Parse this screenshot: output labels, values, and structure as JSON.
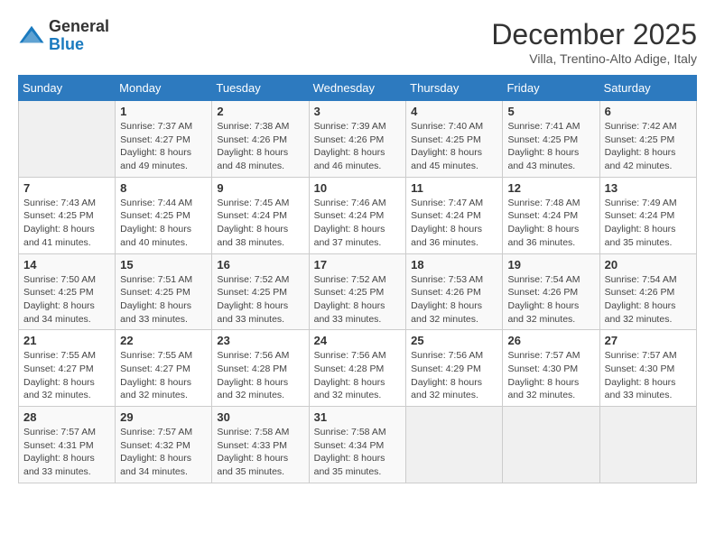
{
  "logo": {
    "line1": "General",
    "line2": "Blue"
  },
  "title": "December 2025",
  "subtitle": "Villa, Trentino-Alto Adige, Italy",
  "weekdays": [
    "Sunday",
    "Monday",
    "Tuesday",
    "Wednesday",
    "Thursday",
    "Friday",
    "Saturday"
  ],
  "weeks": [
    [
      {
        "day": "",
        "info": ""
      },
      {
        "day": "1",
        "info": "Sunrise: 7:37 AM\nSunset: 4:27 PM\nDaylight: 8 hours\nand 49 minutes."
      },
      {
        "day": "2",
        "info": "Sunrise: 7:38 AM\nSunset: 4:26 PM\nDaylight: 8 hours\nand 48 minutes."
      },
      {
        "day": "3",
        "info": "Sunrise: 7:39 AM\nSunset: 4:26 PM\nDaylight: 8 hours\nand 46 minutes."
      },
      {
        "day": "4",
        "info": "Sunrise: 7:40 AM\nSunset: 4:25 PM\nDaylight: 8 hours\nand 45 minutes."
      },
      {
        "day": "5",
        "info": "Sunrise: 7:41 AM\nSunset: 4:25 PM\nDaylight: 8 hours\nand 43 minutes."
      },
      {
        "day": "6",
        "info": "Sunrise: 7:42 AM\nSunset: 4:25 PM\nDaylight: 8 hours\nand 42 minutes."
      }
    ],
    [
      {
        "day": "7",
        "info": "Sunrise: 7:43 AM\nSunset: 4:25 PM\nDaylight: 8 hours\nand 41 minutes."
      },
      {
        "day": "8",
        "info": "Sunrise: 7:44 AM\nSunset: 4:25 PM\nDaylight: 8 hours\nand 40 minutes."
      },
      {
        "day": "9",
        "info": "Sunrise: 7:45 AM\nSunset: 4:24 PM\nDaylight: 8 hours\nand 38 minutes."
      },
      {
        "day": "10",
        "info": "Sunrise: 7:46 AM\nSunset: 4:24 PM\nDaylight: 8 hours\nand 37 minutes."
      },
      {
        "day": "11",
        "info": "Sunrise: 7:47 AM\nSunset: 4:24 PM\nDaylight: 8 hours\nand 36 minutes."
      },
      {
        "day": "12",
        "info": "Sunrise: 7:48 AM\nSunset: 4:24 PM\nDaylight: 8 hours\nand 36 minutes."
      },
      {
        "day": "13",
        "info": "Sunrise: 7:49 AM\nSunset: 4:24 PM\nDaylight: 8 hours\nand 35 minutes."
      }
    ],
    [
      {
        "day": "14",
        "info": "Sunrise: 7:50 AM\nSunset: 4:25 PM\nDaylight: 8 hours\nand 34 minutes."
      },
      {
        "day": "15",
        "info": "Sunrise: 7:51 AM\nSunset: 4:25 PM\nDaylight: 8 hours\nand 33 minutes."
      },
      {
        "day": "16",
        "info": "Sunrise: 7:52 AM\nSunset: 4:25 PM\nDaylight: 8 hours\nand 33 minutes."
      },
      {
        "day": "17",
        "info": "Sunrise: 7:52 AM\nSunset: 4:25 PM\nDaylight: 8 hours\nand 33 minutes."
      },
      {
        "day": "18",
        "info": "Sunrise: 7:53 AM\nSunset: 4:26 PM\nDaylight: 8 hours\nand 32 minutes."
      },
      {
        "day": "19",
        "info": "Sunrise: 7:54 AM\nSunset: 4:26 PM\nDaylight: 8 hours\nand 32 minutes."
      },
      {
        "day": "20",
        "info": "Sunrise: 7:54 AM\nSunset: 4:26 PM\nDaylight: 8 hours\nand 32 minutes."
      }
    ],
    [
      {
        "day": "21",
        "info": "Sunrise: 7:55 AM\nSunset: 4:27 PM\nDaylight: 8 hours\nand 32 minutes."
      },
      {
        "day": "22",
        "info": "Sunrise: 7:55 AM\nSunset: 4:27 PM\nDaylight: 8 hours\nand 32 minutes."
      },
      {
        "day": "23",
        "info": "Sunrise: 7:56 AM\nSunset: 4:28 PM\nDaylight: 8 hours\nand 32 minutes."
      },
      {
        "day": "24",
        "info": "Sunrise: 7:56 AM\nSunset: 4:28 PM\nDaylight: 8 hours\nand 32 minutes."
      },
      {
        "day": "25",
        "info": "Sunrise: 7:56 AM\nSunset: 4:29 PM\nDaylight: 8 hours\nand 32 minutes."
      },
      {
        "day": "26",
        "info": "Sunrise: 7:57 AM\nSunset: 4:30 PM\nDaylight: 8 hours\nand 32 minutes."
      },
      {
        "day": "27",
        "info": "Sunrise: 7:57 AM\nSunset: 4:30 PM\nDaylight: 8 hours\nand 33 minutes."
      }
    ],
    [
      {
        "day": "28",
        "info": "Sunrise: 7:57 AM\nSunset: 4:31 PM\nDaylight: 8 hours\nand 33 minutes."
      },
      {
        "day": "29",
        "info": "Sunrise: 7:57 AM\nSunset: 4:32 PM\nDaylight: 8 hours\nand 34 minutes."
      },
      {
        "day": "30",
        "info": "Sunrise: 7:58 AM\nSunset: 4:33 PM\nDaylight: 8 hours\nand 35 minutes."
      },
      {
        "day": "31",
        "info": "Sunrise: 7:58 AM\nSunset: 4:34 PM\nDaylight: 8 hours\nand 35 minutes."
      },
      {
        "day": "",
        "info": ""
      },
      {
        "day": "",
        "info": ""
      },
      {
        "day": "",
        "info": ""
      }
    ]
  ]
}
